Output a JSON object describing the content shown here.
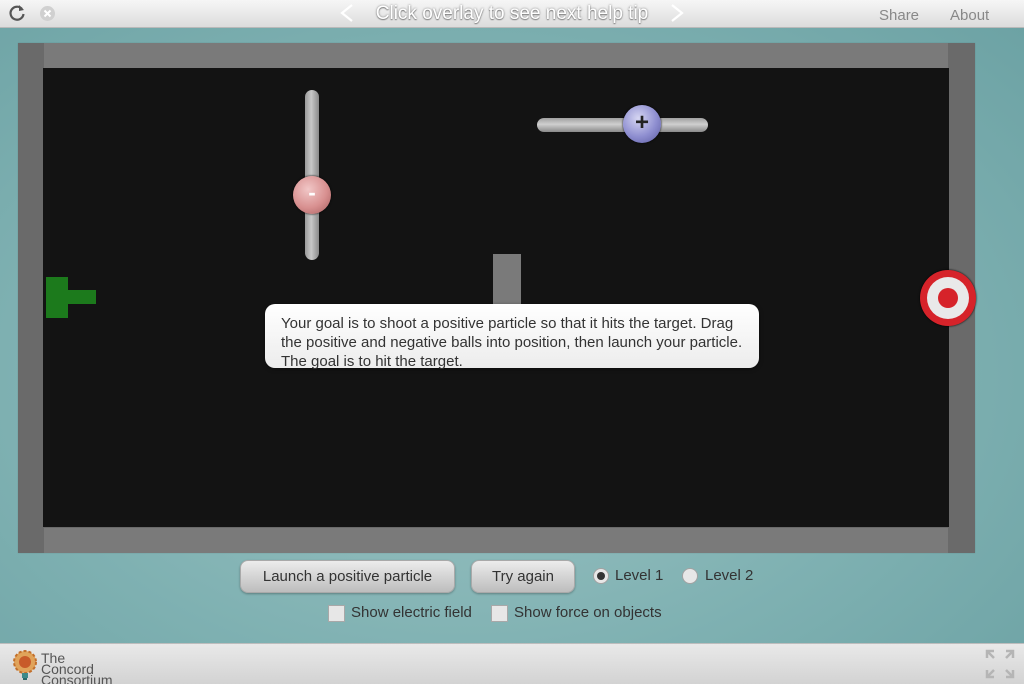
{
  "topbar": {
    "help_tip": "Click overlay to see next help tip",
    "share": "Share",
    "about": "About",
    "icons": [
      "reload-icon",
      "close-icon",
      "chevron-left-icon",
      "chevron-right-icon"
    ]
  },
  "simulation": {
    "negative_ball_symbol": "-",
    "positive_ball_symbol": "+",
    "colors": {
      "launcher": "#1c7a1c",
      "target": "#d6232a",
      "field_background": "#131313"
    }
  },
  "help_tooltip": {
    "text": "Your goal is to shoot a positive particle so that it hits the target. Drag the positive and negative balls into position, then launch your particle. The goal is to hit the target."
  },
  "controls": {
    "launch_button": "Launch a positive particle",
    "retry_button": "Try again",
    "levels": [
      {
        "label": "Level 1",
        "selected": true
      },
      {
        "label": "Level 2",
        "selected": false
      }
    ],
    "show_electric_field": {
      "label": "Show electric field",
      "checked": false
    },
    "show_force": {
      "label": "Show force on objects",
      "checked": false
    }
  },
  "footer": {
    "logo_line1": "The Concord",
    "logo_line2": "Consortium",
    "icons": [
      "concord-logo-icon",
      "fullscreen-icon"
    ]
  }
}
